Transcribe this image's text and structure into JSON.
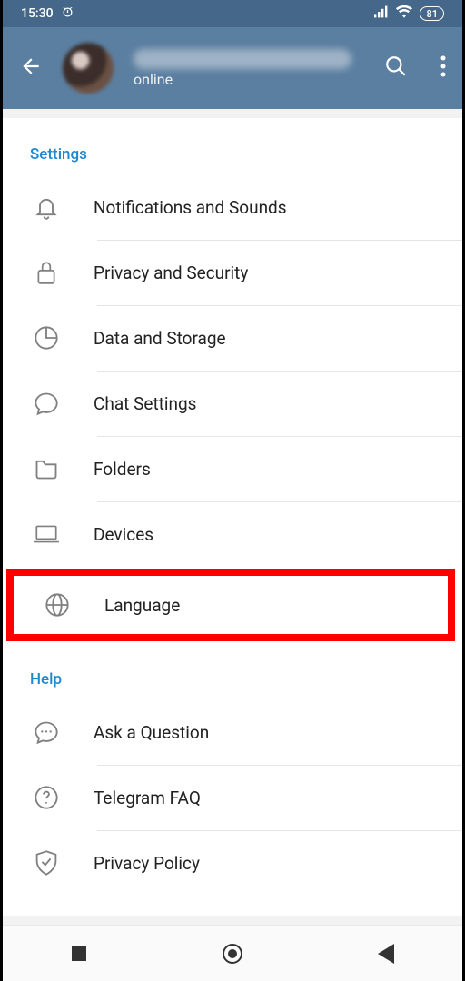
{
  "statusbar": {
    "time": "15:30",
    "battery": "81"
  },
  "header": {
    "status": "online"
  },
  "sections": {
    "settings": {
      "title": "Settings",
      "items": [
        {
          "label": "Notifications and Sounds"
        },
        {
          "label": "Privacy and Security"
        },
        {
          "label": "Data and Storage"
        },
        {
          "label": "Chat Settings"
        },
        {
          "label": "Folders"
        },
        {
          "label": "Devices"
        },
        {
          "label": "Language"
        }
      ]
    },
    "help": {
      "title": "Help",
      "items": [
        {
          "label": "Ask a Question"
        },
        {
          "label": "Telegram FAQ"
        },
        {
          "label": "Privacy Policy"
        }
      ]
    }
  }
}
